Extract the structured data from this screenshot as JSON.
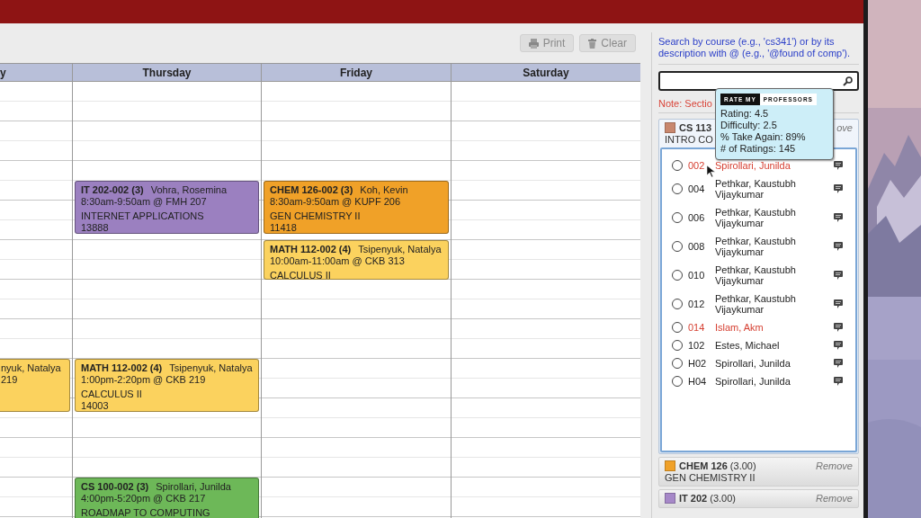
{
  "toolbar": {
    "buttons": [
      {
        "kind": "print",
        "label": "Print"
      },
      {
        "kind": "clear",
        "label": "Clear"
      }
    ]
  },
  "calendar": {
    "days": [
      {
        "name": "y",
        "events": [
          {
            "instructor": "nyuk, Natalya",
            "when": "219",
            "color": "#fbd25e"
          }
        ]
      },
      {
        "name": "Thursday",
        "events": [
          {
            "course": "IT 202-002 (3)",
            "instructor": "Vohra, Rosemina",
            "when": "8:30am-9:50am @ FMH 207",
            "title": "INTERNET APPLICATIONS",
            "crn": "13888",
            "color": "#9b80c0"
          },
          {
            "course": "MATH 112-002 (4)",
            "instructor": "Tsipenyuk, Natalya",
            "when": "1:00pm-2:20pm @ CKB 219",
            "title": "CALCULUS II",
            "crn": "14003",
            "color": "#fbd25e"
          },
          {
            "course": "CS 100-002 (3)",
            "instructor": "Spirollari, Junilda",
            "when": "4:00pm-5:20pm @ CKB 217",
            "title": "ROADMAP TO COMPUTING",
            "color": "#6db858"
          }
        ]
      },
      {
        "name": "Friday",
        "events": [
          {
            "course": "CHEM 126-002 (3)",
            "instructor": "Koh, Kevin",
            "when": "8:30am-9:50am @ KUPF 206",
            "title": "GEN CHEMISTRY II",
            "crn": "11418",
            "color": "#f0a128"
          },
          {
            "course": "MATH 112-002 (4)",
            "instructor": "Tsipenyuk, Natalya",
            "when": "10:00am-11:00am @ CKB 313",
            "title": "CALCULUS II",
            "color": "#fbd25e"
          }
        ]
      },
      {
        "name": "Saturday"
      }
    ]
  },
  "sidebar": {
    "hint": "Search by course (e.g., 'cs341') or by its description with @ (e.g., '@found of comp').",
    "note": "Note: Sectio",
    "courses": [
      {
        "code": "CS 113",
        "title": "INTRO CO",
        "remove": "ove",
        "color": "#c8876e",
        "expanded": true,
        "sections": [
          {
            "number": "002",
            "instructor": "Spirollari, Junilda",
            "selected": false,
            "warning": true
          },
          {
            "number": "004",
            "instructor": "Pethkar, Kaustubh Vijaykumar",
            "selected": false,
            "warning": false
          },
          {
            "number": "006",
            "instructor": "Pethkar, Kaustubh Vijaykumar",
            "selected": false,
            "warning": false
          },
          {
            "number": "008",
            "instructor": "Pethkar, Kaustubh Vijaykumar",
            "selected": false,
            "warning": false
          },
          {
            "number": "010",
            "instructor": "Pethkar, Kaustubh Vijaykumar",
            "selected": false,
            "warning": false
          },
          {
            "number": "012",
            "instructor": "Pethkar, Kaustubh Vijaykumar",
            "selected": false,
            "warning": false
          },
          {
            "number": "014",
            "instructor": "Islam, Akm",
            "selected": false,
            "warning": true
          },
          {
            "number": "102",
            "instructor": "Estes, Michael",
            "selected": false,
            "warning": false
          },
          {
            "number": "H02",
            "instructor": "Spirollari, Junilda",
            "selected": false,
            "warning": false
          },
          {
            "number": "H04",
            "instructor": "Spirollari, Junilda",
            "selected": false,
            "warning": false
          }
        ]
      },
      {
        "code": "CHEM 126",
        "credits": "(3.00)",
        "title": "GEN CHEMISTRY II",
        "remove": "Remove",
        "color": "#f0a128",
        "expanded": false
      },
      {
        "code": "IT 202",
        "credits": "(3.00)",
        "remove": "Remove",
        "color": "#a688c8",
        "expanded": false
      }
    ],
    "tooltip": {
      "logo_left": "RATE MY",
      "logo_right": "PROFESSORS",
      "lines": [
        "Rating: 4.5",
        "Difficulty: 2.5",
        "% Take Again: 89%",
        "# of Ratings: 145"
      ]
    }
  }
}
